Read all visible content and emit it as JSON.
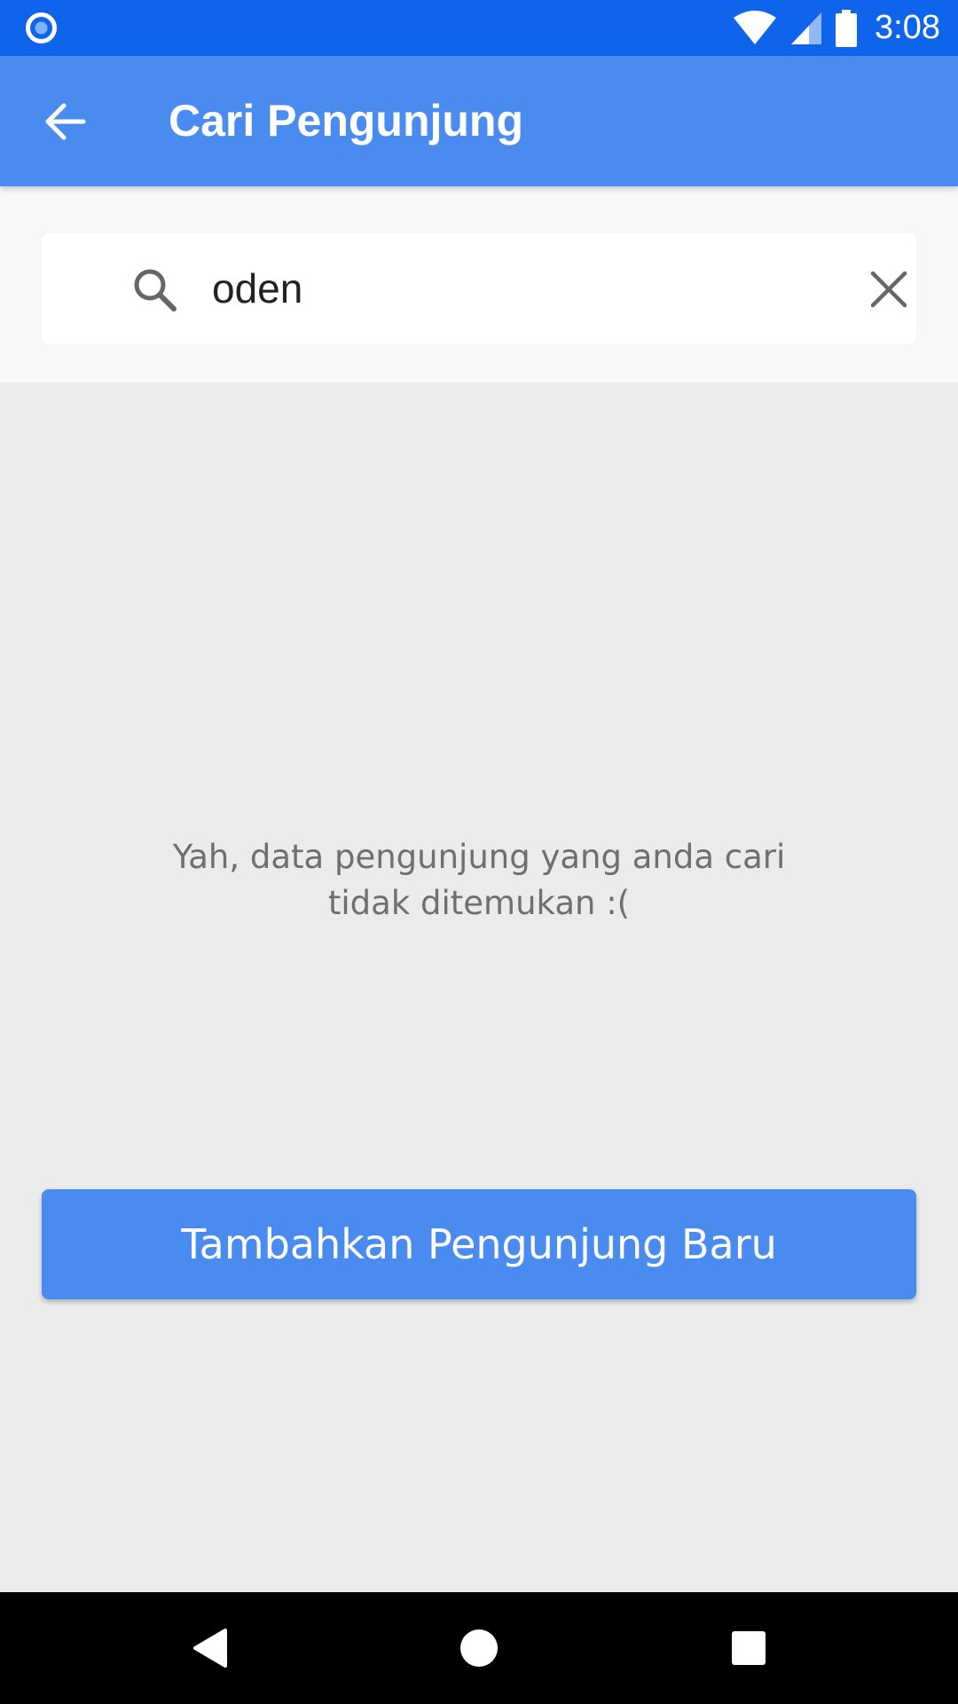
{
  "status_bar": {
    "time": "3:08",
    "icons": [
      "notification-circle-icon",
      "wifi-icon",
      "signal-icon",
      "battery-icon"
    ],
    "color": "#0f64ec"
  },
  "app_bar": {
    "title": "Cari Pengunjung",
    "back_icon": "arrow-back-icon",
    "color": "#4a8bf0"
  },
  "search": {
    "value": "oden",
    "search_icon": "search-icon",
    "clear_icon": "close-icon"
  },
  "empty_state": {
    "message_line1": "Yah, data pengunjung yang anda cari",
    "message_line2": "tidak ditemukan :("
  },
  "add_button": {
    "label": "Tambahkan Pengunjung Baru",
    "color": "#4a8bf0"
  },
  "nav_bar": {
    "buttons": [
      "back-triangle-icon",
      "home-circle-icon",
      "recents-square-icon"
    ]
  }
}
